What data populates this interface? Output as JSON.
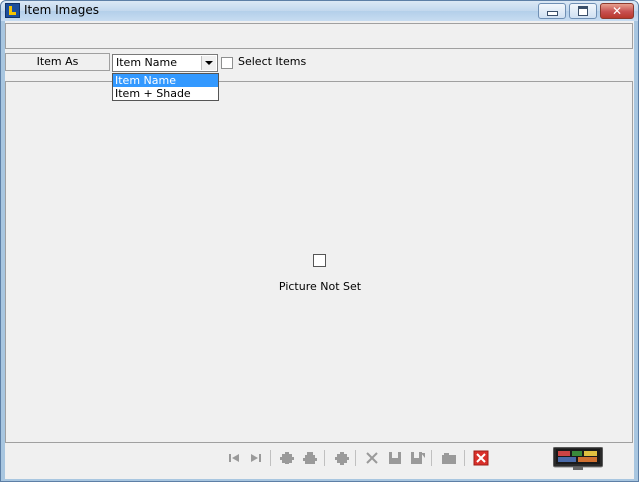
{
  "window": {
    "title": "Item Images",
    "controls": {
      "minimize": "minimize",
      "maximize": "maximize",
      "close": "✕"
    }
  },
  "filter": {
    "item_as_label": "Item As",
    "combo_value": "Item Name",
    "options": [
      "Item Name",
      "Item + Shade"
    ],
    "selected_option": "Item Name",
    "select_items_label": "Select Items",
    "select_items_checked": false
  },
  "picture": {
    "status_text": "Picture Not Set"
  },
  "toolbar": {
    "buttons": [
      "first-icon",
      "last-icon",
      "add-icon",
      "edit-icon",
      "view-icon",
      "delete-icon",
      "save-icon",
      "save-as-icon",
      "camera-icon",
      "close-form-icon"
    ],
    "accent_color": "#d9302a"
  }
}
